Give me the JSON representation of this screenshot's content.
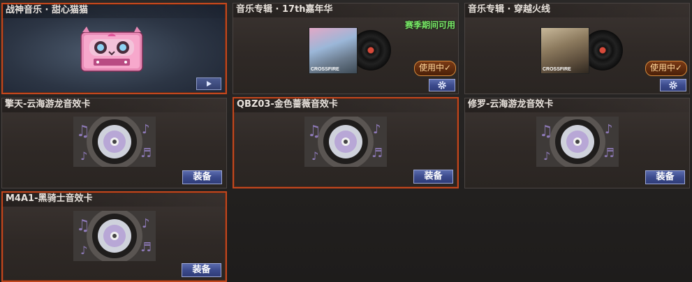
{
  "cards": [
    {
      "title": "战神音乐 · 甜心猫猫"
    },
    {
      "title": "音乐专辑 · 17th嘉年华",
      "badge": "赛季期间可用",
      "status": "使用中✓"
    },
    {
      "title": "音乐专辑 · 穿越火线",
      "status": "使用中✓"
    },
    {
      "title": "擎天-云海游龙音效卡",
      "button": "装备"
    },
    {
      "title": "QBZ03-金色蔷薇音效卡",
      "button": "装备"
    },
    {
      "title": "修罗-云海游龙音效卡",
      "button": "装备"
    },
    {
      "title": "M4A1-黑骑士音效卡",
      "button": "装备"
    }
  ],
  "cover_logo": "CROSSFIRE",
  "colors": {
    "season_green": "#7cf06a",
    "select_border": "#c2471e",
    "button_blue": "#3c4b8d"
  }
}
